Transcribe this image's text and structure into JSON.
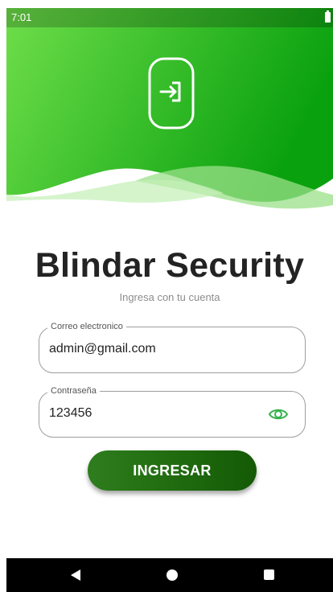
{
  "status_bar": {
    "time": "7:01"
  },
  "header": {
    "icon": "login-door-arrow-icon",
    "gradient_colors": [
      "#6ede4a",
      "#0aa10f"
    ]
  },
  "app_title": "Blindar Security",
  "subtitle": "Ingresa con tu cuenta",
  "form": {
    "email": {
      "label": "Correo electronico",
      "value": "admin@gmail.com"
    },
    "password": {
      "label": "Contraseña",
      "value": "123456",
      "toggle_icon": "eye-icon"
    },
    "submit_label": "INGRESAR"
  },
  "nav_bar": {
    "back_icon": "back-triangle-icon",
    "home_icon": "home-circle-icon",
    "recents_icon": "recents-square-icon"
  },
  "colors": {
    "accent": "#37b24d",
    "button": "#1f6a0e",
    "title": "#232323"
  }
}
